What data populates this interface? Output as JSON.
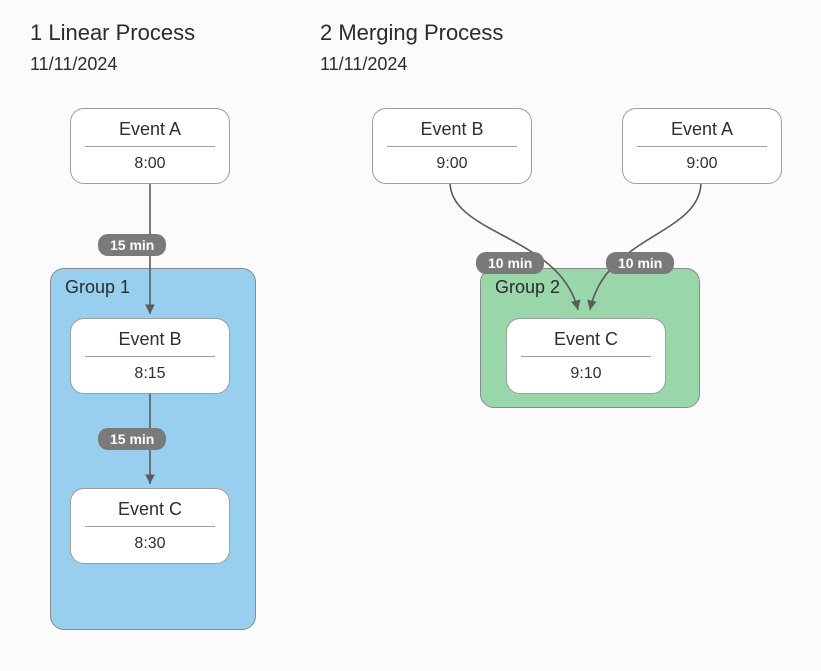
{
  "left": {
    "title": "1 Linear Process",
    "date": "11/11/2024",
    "group_label": "Group 1",
    "nodes": {
      "a": {
        "name": "Event A",
        "time": "8:00"
      },
      "b": {
        "name": "Event B",
        "time": "8:15"
      },
      "c": {
        "name": "Event C",
        "time": "8:30"
      }
    },
    "edges": {
      "ab": "15 min",
      "bc": "15 min"
    }
  },
  "right": {
    "title": "2 Merging Process",
    "date": "11/11/2024",
    "group_label": "Group 2",
    "nodes": {
      "b": {
        "name": "Event B",
        "time": "9:00"
      },
      "a": {
        "name": "Event A",
        "time": "9:00"
      },
      "c": {
        "name": "Event C",
        "time": "9:10"
      }
    },
    "edges": {
      "bc": "10 min",
      "ac": "10 min"
    }
  },
  "chart_data": [
    {
      "type": "flow-diagram",
      "title": "1 Linear Process",
      "date": "11/11/2024",
      "nodes": [
        {
          "id": "A",
          "label": "Event A",
          "time": "8:00"
        },
        {
          "id": "B",
          "label": "Event B",
          "time": "8:15",
          "group": "Group 1"
        },
        {
          "id": "C",
          "label": "Event C",
          "time": "8:30",
          "group": "Group 1"
        }
      ],
      "edges": [
        {
          "from": "A",
          "to": "B",
          "label": "15 min"
        },
        {
          "from": "B",
          "to": "C",
          "label": "15 min"
        }
      ],
      "groups": [
        {
          "id": "Group 1",
          "color": "#98ceee",
          "members": [
            "B",
            "C"
          ]
        }
      ]
    },
    {
      "type": "flow-diagram",
      "title": "2 Merging Process",
      "date": "11/11/2024",
      "nodes": [
        {
          "id": "B",
          "label": "Event B",
          "time": "9:00"
        },
        {
          "id": "A",
          "label": "Event A",
          "time": "9:00"
        },
        {
          "id": "C",
          "label": "Event C",
          "time": "9:10",
          "group": "Group 2"
        }
      ],
      "edges": [
        {
          "from": "B",
          "to": "C",
          "label": "10 min"
        },
        {
          "from": "A",
          "to": "C",
          "label": "10 min"
        }
      ],
      "groups": [
        {
          "id": "Group 2",
          "color": "#99d6a9",
          "members": [
            "C"
          ]
        }
      ]
    }
  ]
}
